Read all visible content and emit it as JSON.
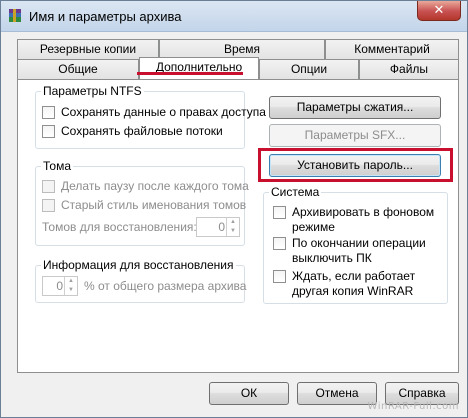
{
  "window": {
    "title": "Имя и параметры архива",
    "close_symbol": "✕"
  },
  "tabs_row_top": [
    {
      "label": "Резервные копии"
    },
    {
      "label": "Время"
    },
    {
      "label": "Комментарий"
    }
  ],
  "tabs_row_bottom": [
    {
      "label": "Общие"
    },
    {
      "label": "Дополнительно",
      "active": true
    },
    {
      "label": "Опции"
    },
    {
      "label": "Файлы"
    }
  ],
  "ntfs": {
    "title": "Параметры NTFS",
    "save_security": "Сохранять данные о правах доступа",
    "save_streams": "Сохранять файловые потоки"
  },
  "volumes": {
    "title": "Тома",
    "pause": "Делать паузу после каждого тома",
    "old_style": "Старый стиль именования томов",
    "recovery_label": "Томов для восстановления:",
    "recovery_value": "0"
  },
  "recovery": {
    "title": "Информация для восстановления",
    "value": "0",
    "suffix": "% от общего размера архива"
  },
  "buttons": {
    "compression": "Параметры сжатия...",
    "sfx": "Параметры SFX...",
    "password": "Установить пароль...",
    "ok": "ОК",
    "cancel": "Отмена",
    "help": "Справка"
  },
  "system": {
    "title": "Система",
    "background": "Архивировать в фоновом режиме",
    "shutdown": "По окончании операции выключить ПК",
    "wait": "Ждать, если работает другая копия WinRAR"
  },
  "watermark": "WinRAR-Full.com"
}
